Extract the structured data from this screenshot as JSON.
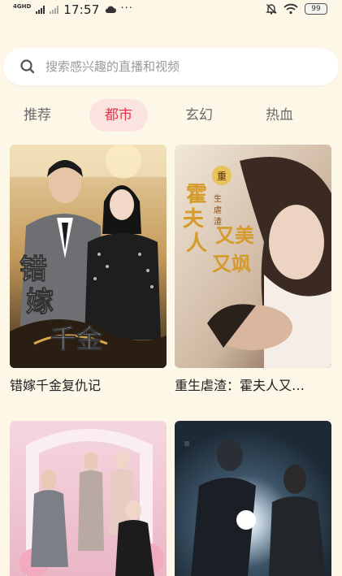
{
  "status_bar": {
    "network": "4GHD",
    "time": "17:57",
    "more": "···",
    "battery": "99"
  },
  "search": {
    "placeholder": "搜索感兴趣的直播和视频"
  },
  "tabs": [
    {
      "label": "推荐",
      "active": false
    },
    {
      "label": "都市",
      "active": true
    },
    {
      "label": "玄幻",
      "active": false
    },
    {
      "label": "热血",
      "active": false
    }
  ],
  "cards": [
    {
      "title": "错嫁千金复仇记",
      "poster_text": "错嫁千金复仇记"
    },
    {
      "title": "重生虐渣：霍夫人又…",
      "poster_text": "霍夫人又美又飒",
      "poster_badge": "重生虐渣"
    },
    {
      "title": "",
      "poster_text": ""
    },
    {
      "title": "",
      "poster_text": ""
    }
  ],
  "colors": {
    "background": "#fdf7e8",
    "accent": "#e8334e",
    "active_tab_bg": "#fbe3df"
  }
}
